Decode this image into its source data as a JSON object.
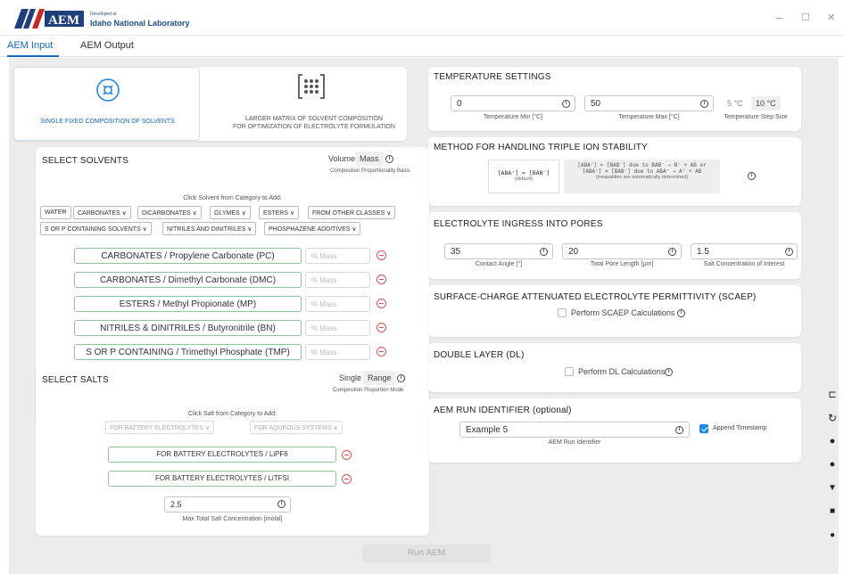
{
  "titlebar": {
    "developed_at": "Developed at",
    "lab_name": "Idaho National Laboratory",
    "min": "–",
    "max": "☐",
    "close": "✕"
  },
  "tabs": [
    "AEM Input",
    "AEM Output"
  ],
  "modes": {
    "single": "SINGLE FIXED COMPOSITION OF SOLVENTS",
    "matrix_line1": "LARGER MATRIX OF SOLVENT COMPOSITION",
    "matrix_line2": "FOR OPTIMIZATION OF ELECTROLYTE FORMULATION"
  },
  "solvents": {
    "title": "SELECT SOLVENTS",
    "toggle": [
      "Volume",
      "Mass"
    ],
    "basis": "Composition Proportionality Basis",
    "click_hint": "Click Solvent from Category to Add:",
    "categories_row1": [
      "WATER",
      "CARBONATES ∨",
      "DICARBONATES ∨",
      "GLYMES ∨",
      "ESTERS ∨",
      "FROM OTHER CLASSES ∨"
    ],
    "categories_row2": [
      "S OR P CONTAINING SOLVENTS ∨",
      "NITRILES AND DINITRILES ∨",
      "PHOSPHAZENE ADDITIVES ∨"
    ],
    "items": [
      "CARBONATES / Propylene Carbonate (PC)",
      "CARBONATES / Dimethyl Carbonate (DMC)",
      "ESTERS / Methyl Propionate (MP)",
      "NITRILES & DINITRILES / Butyronitrile (BN)",
      "S OR P CONTAINING / Trimethyl Phosphate (TMP)"
    ],
    "mass_placeholder": "% Mass"
  },
  "salts": {
    "title": "SELECT SALTS",
    "toggle": [
      "Single",
      "Range"
    ],
    "mode": "Composition Proportion Mode",
    "click_hint": "Click Salt from Category to Add:",
    "categories": [
      "FOR BATTERY ELECTROLYTES ∨",
      "FOR AQUEOUS SYSTEMS ∨"
    ],
    "items": [
      "FOR BATTERY ELECTROLYTES / LiPF6",
      "FOR BATTERY ELECTROLYTES / LiTFSI"
    ],
    "max_value": "2.5",
    "max_label": "Max Total Salt Concentration [molal]"
  },
  "temperature": {
    "title": "TEMPERATURE SETTINGS",
    "min_value": "0",
    "min_label": "Temperature Min [°C]",
    "max_value": "50",
    "max_label": "Temperature Max [°C]",
    "steps": [
      "5 °C",
      "10 °C"
    ],
    "step_label": "Temperature Step Size"
  },
  "triple_ion": {
    "title": "METHOD FOR HANDLING TRIPLE ION STABILITY",
    "opt1_eq": "[ABA⁺] = [BAB⁻]",
    "opt1_sub": "(default)",
    "opt2_line1": "[ABA⁺] > [BAB⁻] due to BAB⁻ → B⁻ + AB or",
    "opt2_line2": "[ABA⁺] < [BAB⁻] due to ABA⁺ → A⁺ + AB",
    "opt2_sub": "(inequalities are automatically determined)"
  },
  "ingress": {
    "title": "ELECTROLYTE INGRESS INTO PORES",
    "contact_value": "35",
    "contact_label": "Contact Angle [°]",
    "pore_value": "20",
    "pore_label": "Total Pore Length [μm]",
    "salt_value": "1.5",
    "salt_label": "Salt Concentration of Interest"
  },
  "scaep": {
    "title": "SURFACE-CHARGE ATTENUATED ELECTROLYTE PERMITTIVITY (SCAEP)",
    "check_label": "Perform SCAEP Calculations"
  },
  "dl": {
    "title": "DOUBLE LAYER (DL)",
    "check_label": "Perform DL Calculations"
  },
  "run_id": {
    "title": "AEM RUN IDENTIFIER (optional)",
    "value": "Example 5",
    "label": "AEM Run Identifier",
    "append": "Append Timestamp"
  },
  "run_button": "Run AEM",
  "info_glyph": "i",
  "colors": {
    "accent": "#1565c0",
    "remove": "#d9534f",
    "field_border_added": "#8fc49a"
  }
}
